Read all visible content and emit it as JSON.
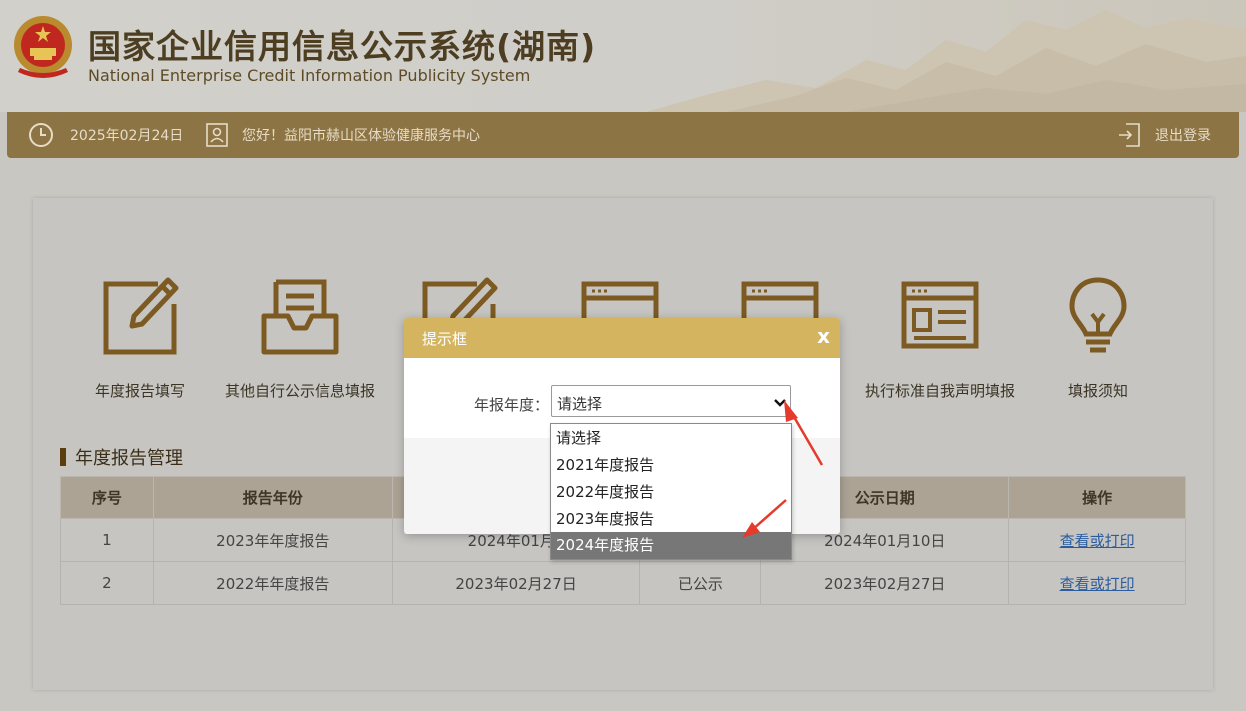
{
  "header": {
    "title_cn": "国家企业信用信息公示系统(湖南)",
    "title_en": "National Enterprise Credit Information Publicity System",
    "emblem_icon": "national-emblem-icon"
  },
  "userbar": {
    "date": "2025年02月24日",
    "greeting": "您好！益阳市赫山区体验健康服务中心",
    "logout": "退出登录",
    "icons": {
      "clock": "clock-icon",
      "user": "user-card-icon",
      "logout": "logout-icon"
    }
  },
  "menu": {
    "items": [
      {
        "label": "年度报告填写",
        "icon": "edit-form-icon"
      },
      {
        "label": "其他自行公示信息填报",
        "icon": "inbox-tray-icon"
      },
      {
        "label": "",
        "icon": "edit-form-icon"
      },
      {
        "label": "",
        "icon": "browser-window-icon"
      },
      {
        "label": "",
        "icon": "browser-window-icon"
      },
      {
        "label": "执行标准自我声明填报",
        "icon": "browser-window-icon"
      },
      {
        "label": "填报须知",
        "icon": "lightbulb-icon"
      }
    ]
  },
  "section": {
    "title": "年度报告管理"
  },
  "table": {
    "headers": [
      "序号",
      "报告年份",
      "",
      "",
      "公示日期",
      "操作"
    ],
    "rows": [
      {
        "no": "1",
        "year": "2023年年度报告",
        "fill_date": "2024年01月1",
        "status": "",
        "publish_date": "2024年01月10日",
        "action": "查看或打印"
      },
      {
        "no": "2",
        "year": "2022年年度报告",
        "fill_date": "2023年02月27日",
        "status": "已公示",
        "publish_date": "2023年02月27日",
        "action": "查看或打印"
      }
    ]
  },
  "dialog": {
    "title": "提示框",
    "close": "x",
    "field_label": "年报年度：",
    "select_value": "请选择"
  },
  "dropdown": {
    "options": [
      "请选择",
      "2021年度报告",
      "2022年度报告",
      "2023年度报告",
      "2024年度报告"
    ],
    "highlighted": "2024年度报告"
  },
  "colors": {
    "accent_bar": "#8d7444",
    "dialog_header": "#d4b45f",
    "arrow": "#e53a2c",
    "link": "#2b5c9e"
  }
}
